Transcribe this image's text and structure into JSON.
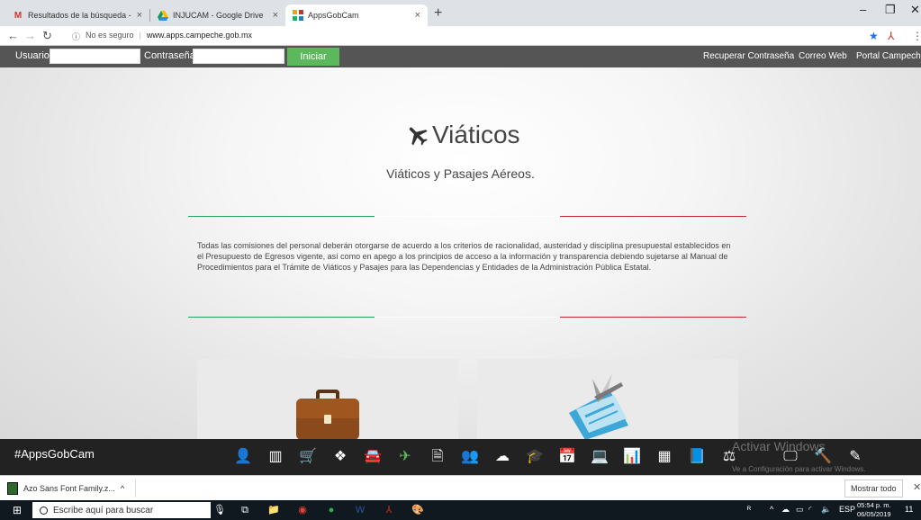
{
  "browser": {
    "tabs": [
      {
        "title": "Resultados de la búsqueda - cor",
        "icon": "gmail-icon",
        "active": false
      },
      {
        "title": "INJUCAM - Google Drive",
        "icon": "google-drive-icon",
        "active": false
      },
      {
        "title": "AppsGobCam",
        "icon": "apps-icon",
        "active": true
      }
    ],
    "security_label": "No es seguro",
    "url": "www.apps.campeche.gob.mx"
  },
  "login": {
    "user_label": "Usuario",
    "password_label": "Contraseña",
    "submit_label": "Iniciar",
    "user_value": "",
    "password_value": ""
  },
  "top_links": [
    "Recuperar Contraseña",
    "Correo Web",
    "Portal Campeche"
  ],
  "hero": {
    "title": "Viáticos",
    "subtitle": "Viáticos y Pasajes Aéreos.",
    "body": "Todas las comisiones del personal deberán otorgarse de acuerdo a los criterios de racionalidad, austeridad y disciplina presupuestal establecidos en el Presupuesto de Egresos vigente, así como en apego a los principios de acceso a la información y transparencia debiendo sujetarse al Manual de Procedimientos para el Trámite de Viáticos y Pasajes para las Dependencias y Entidades de la Administración Pública Estatal."
  },
  "appbar": {
    "brand": "#AppsGobCam",
    "icons": [
      "user-icon",
      "building-icon",
      "cart-icon",
      "cubes-icon",
      "car-icon",
      "plane-icon",
      "document-icon",
      "add-user-icon",
      "cloud-icon",
      "graduation-cap-icon",
      "calendar-icon",
      "laptop-icon",
      "bar-chart-icon",
      "calculator-icon",
      "book-icon",
      "scale-icon",
      "monitor-icon",
      "gavel-icon",
      "edit-icon"
    ],
    "active_icon": "plane-icon",
    "watermark_title": "Activar Windows",
    "watermark_sub": "Ve a Configuración para activar Windows."
  },
  "downloads": {
    "file": "Azo Sans Font Family.z...",
    "show_all": "Mostrar todo"
  },
  "taskbar": {
    "search_placeholder": "Escribe aquí para buscar",
    "lang": "ESP",
    "time": "05:54 p. m.",
    "date": "06/05/2019",
    "notifications": "11"
  }
}
